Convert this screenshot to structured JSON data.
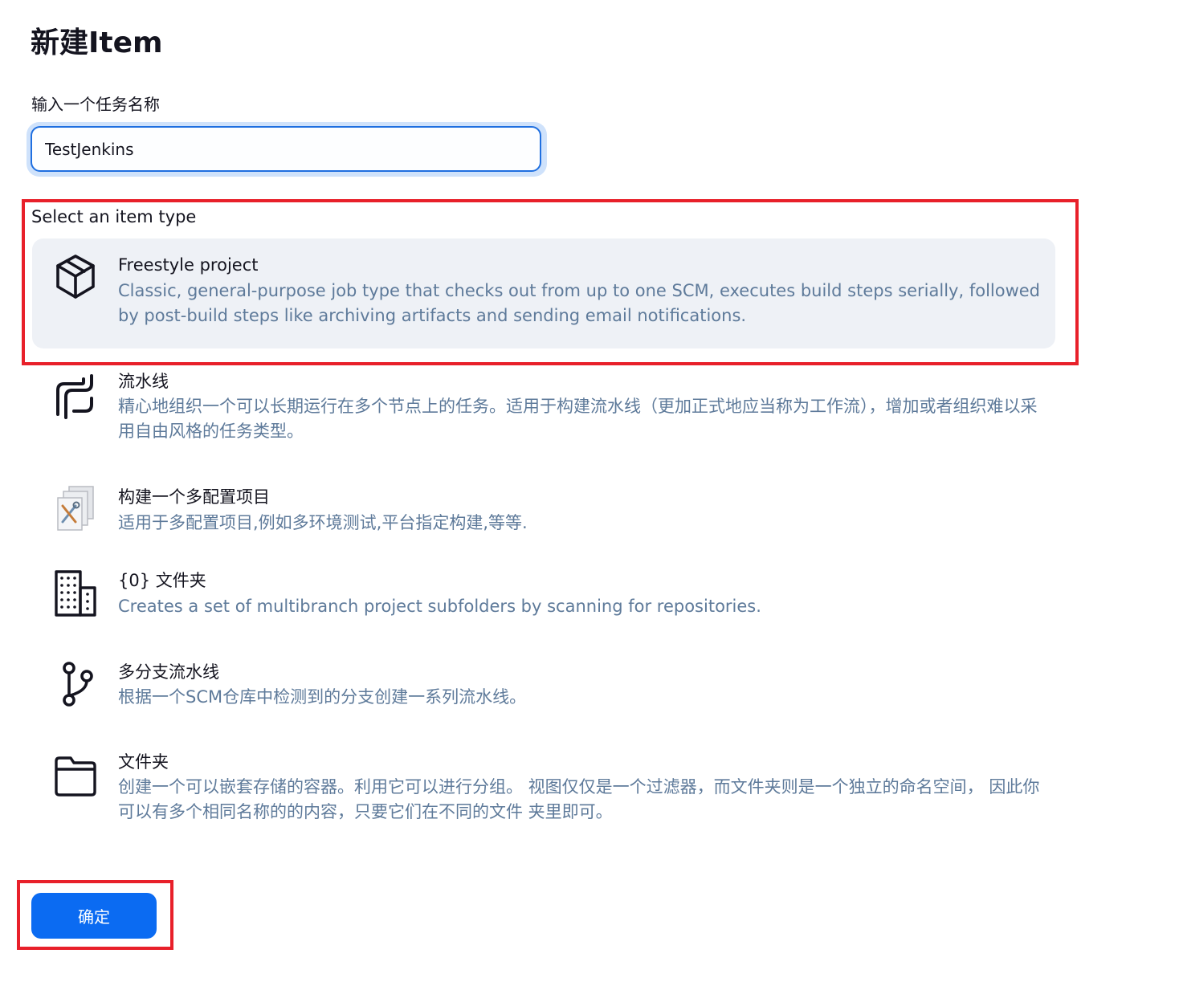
{
  "page": {
    "title": "新建Item"
  },
  "name_field": {
    "label": "输入一个任务名称",
    "value": "TestJenkins"
  },
  "item_types": {
    "label": "Select an item type",
    "items": [
      {
        "name": "Freestyle project",
        "description": "Classic, general-purpose job type that checks out from up to one SCM, executes build steps serially, followed by post-build steps like archiving artifacts and sending email notifications.",
        "icon": "freestyle-box-icon",
        "selected": true
      },
      {
        "name": "流水线",
        "description": "精心地组织一个可以长期运行在多个节点上的任务。适用于构建流水线（更加正式地应当称为工作流），增加或者组织难以采用自由风格的任务类型。",
        "icon": "pipeline-icon",
        "selected": false
      },
      {
        "name": "构建一个多配置项目",
        "description": "适用于多配置项目,例如多环境测试,平台指定构建,等等.",
        "icon": "multi-config-icon",
        "selected": false
      },
      {
        "name": "{0} 文件夹",
        "description": "Creates a set of multibranch project subfolders by scanning for repositories.",
        "icon": "organization-folder-icon",
        "selected": false
      },
      {
        "name": "多分支流水线",
        "description": "根据一个SCM仓库中检测到的分支创建一系列流水线。",
        "icon": "branch-icon",
        "selected": false
      },
      {
        "name": "文件夹",
        "description": "创建一个可以嵌套存储的容器。利用它可以进行分组。 视图仅仅是一个过滤器，而文件夹则是一个独立的命名空间， 因此你可以有多个相同名称的的内容，只要它们在不同的文件 夹里即可。",
        "icon": "folder-icon",
        "selected": false
      }
    ]
  },
  "actions": {
    "ok_label": "确定"
  },
  "colors": {
    "accent": "#0b6bf2",
    "description_text": "#5e7a9a",
    "selected_background": "#eef1f6",
    "annotation_red": "#e8202a"
  }
}
